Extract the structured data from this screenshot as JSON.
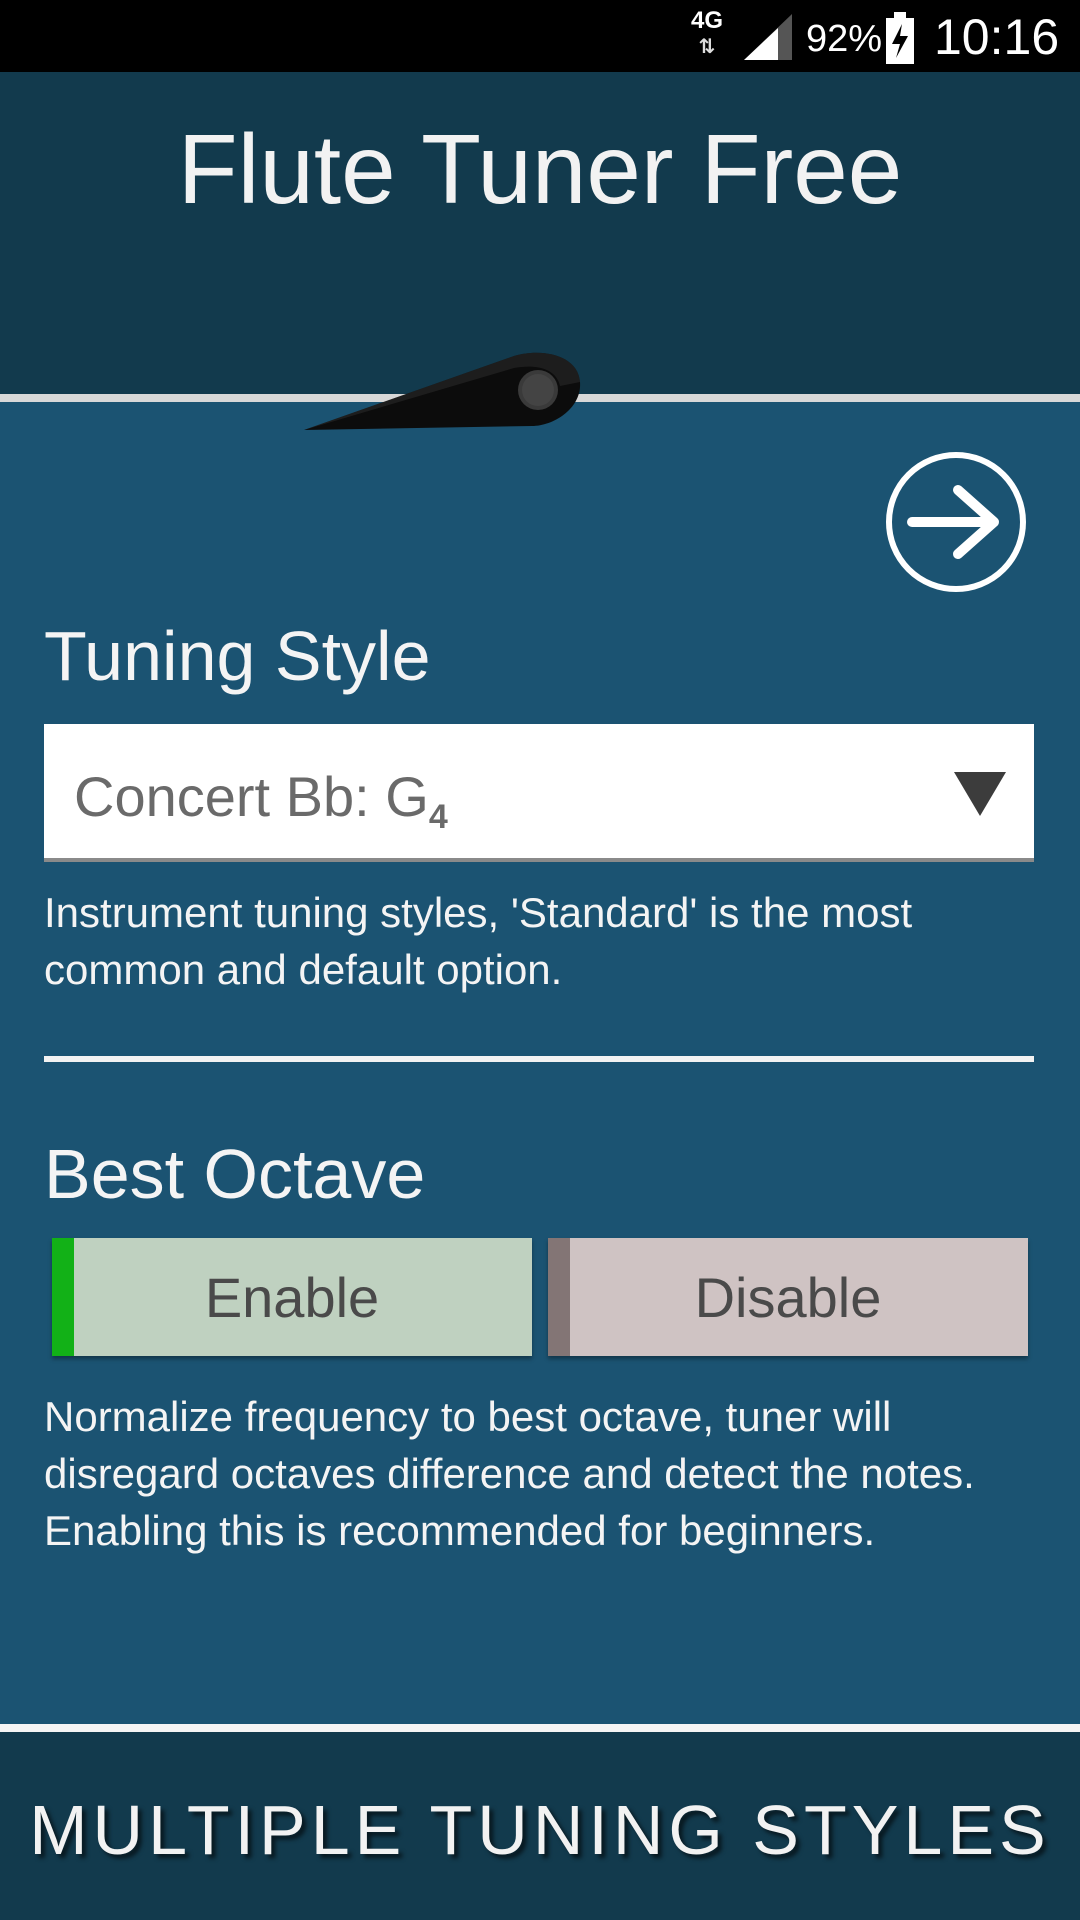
{
  "status_bar": {
    "network": "4G",
    "network_arrows": "⇅",
    "battery_percent": "92%",
    "time": "10:16"
  },
  "app": {
    "title": "Flute Tuner Free"
  },
  "tuning_style": {
    "title": "Tuning Style",
    "selected": "Concert Bb: G",
    "selected_subscript": "4",
    "description": "Instrument tuning styles, 'Standard' is the most common and default option."
  },
  "best_octave": {
    "title": "Best Octave",
    "enable_label": "Enable",
    "disable_label": "Disable",
    "selected": "Enable",
    "description": "Normalize frequency to best octave, tuner will disregard octaves difference and detect the notes. Enabling this is recommended for beginners."
  },
  "footer": {
    "text": "MULTIPLE TUNING STYLES"
  },
  "colors": {
    "background": "#1b5372",
    "header": "#123a4d",
    "enable_accent": "#12b117",
    "disable_accent": "#837575"
  },
  "icons": {
    "next": "arrow-right-circle-icon",
    "dropdown": "caret-down-icon",
    "needle": "tuner-needle-icon"
  }
}
